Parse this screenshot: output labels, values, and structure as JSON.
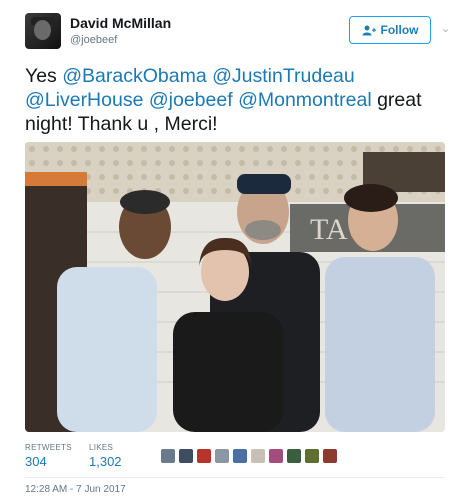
{
  "author": {
    "name": "David McMillan",
    "handle": "@joebeef"
  },
  "follow_button": {
    "label": "Follow"
  },
  "tweet": {
    "segments": [
      {
        "text": "Yes ",
        "mention": false
      },
      {
        "text": "@BarackObama",
        "mention": true
      },
      {
        "text": " ",
        "mention": false
      },
      {
        "text": "@JustinTrudeau",
        "mention": true
      },
      {
        "text": " ",
        "mention": false
      },
      {
        "text": "@LiverHouse",
        "mention": true
      },
      {
        "text": " ",
        "mention": false
      },
      {
        "text": "@joebeef",
        "mention": true
      },
      {
        "text": " ",
        "mention": false
      },
      {
        "text": "@Monmontreal",
        "mention": true
      },
      {
        "text": " great night! Thank u , Merci!",
        "mention": false
      }
    ]
  },
  "photo": {
    "sign_text": "TAUR"
  },
  "stats": {
    "retweets_label": "RETWEETS",
    "retweets": "304",
    "likes_label": "LIKES",
    "likes": "1,302"
  },
  "likers": {
    "count": 10,
    "colors": [
      "#6b7a8c",
      "#3d4c5e",
      "#b8342a",
      "#8a96a3",
      "#4a6fa0",
      "#c9c0b5",
      "#a44c7c",
      "#3b5e3e",
      "#5d6e2f",
      "#8c3b2c"
    ]
  },
  "timestamp": "12:28 AM - 7 Jun 2017",
  "colors": {
    "accent": "#1da1f2",
    "link": "#1b7ab6",
    "muted": "#657786"
  }
}
